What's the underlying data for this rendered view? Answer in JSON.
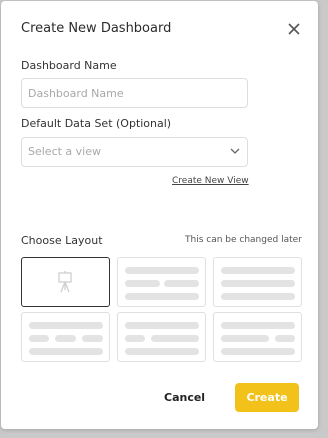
{
  "modal": {
    "title": "Create New Dashboard"
  },
  "form": {
    "name_label": "Dashboard Name",
    "name_placeholder": "Dashboard Name",
    "name_value": "",
    "dataset_label": "Default Data Set (Optional)",
    "dataset_placeholder": "Select a view",
    "create_view_link": "Create New View"
  },
  "layout": {
    "label": "Choose Layout",
    "hint": "This can be changed later",
    "selected_index": 0,
    "options": [
      "presentation",
      "layout-2",
      "layout-3",
      "layout-4",
      "layout-5",
      "layout-6"
    ]
  },
  "actions": {
    "cancel_label": "Cancel",
    "create_label": "Create"
  },
  "colors": {
    "accent": "#f2c21b",
    "placeholder_bar": "#e3e3e3",
    "selected_border": "#333333"
  },
  "icons": {
    "close": "close-icon",
    "chevron": "chevron-down-icon",
    "presentation": "presentation-easel-icon"
  }
}
